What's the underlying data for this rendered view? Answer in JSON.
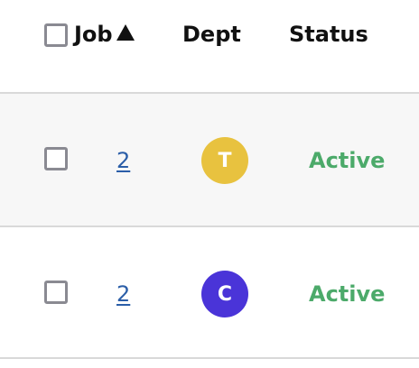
{
  "header": {
    "job_label": "Job",
    "dept_label": "Dept",
    "status_label": "Status"
  },
  "rows": [
    {
      "job": "2",
      "dept_initial": "T",
      "dept_color": "#e8c23f",
      "status": "Active"
    },
    {
      "job": "2",
      "dept_initial": "C",
      "dept_color": "#4a34d8",
      "status": "Active"
    }
  ],
  "colors": {
    "status_active": "#4caa6a",
    "link": "#2b5ea8"
  },
  "icons": {
    "sort": "sort-ascending-icon"
  }
}
